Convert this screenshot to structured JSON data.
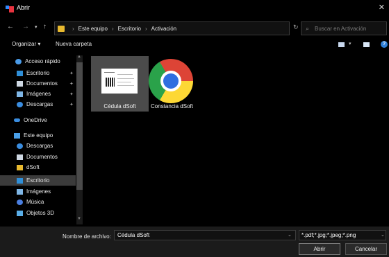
{
  "window": {
    "title": "Abrir",
    "close_icon": "close-icon"
  },
  "nav": {
    "breadcrumb": [
      "Este equipo",
      "Escritorio",
      "Activación"
    ],
    "search_placeholder": "Buscar en Activación"
  },
  "toolbar": {
    "organize": "Organizar ▾",
    "new_folder": "Nueva carpeta",
    "help": "?"
  },
  "sidebar": {
    "items": [
      {
        "label": "Acceso rápido",
        "icon": "star-icon",
        "color": "#4a9be8",
        "pinned": false,
        "selected": false
      },
      {
        "label": "Escritorio",
        "icon": "desktop-icon",
        "color": "#2f8fd8",
        "pinned": true,
        "selected": false
      },
      {
        "label": "Documentos",
        "icon": "documents-icon",
        "color": "#cfd8e3",
        "pinned": true,
        "selected": false
      },
      {
        "label": "Imágenes",
        "icon": "pictures-icon",
        "color": "#7fb6e6",
        "pinned": true,
        "selected": false
      },
      {
        "label": "Descargas",
        "icon": "download-icon",
        "color": "#3a8de0",
        "pinned": true,
        "selected": false
      },
      {
        "label": "OneDrive",
        "icon": "onedrive-icon",
        "color": "#3a8de0",
        "pinned": false,
        "selected": false
      },
      {
        "label": "Este equipo",
        "icon": "computer-icon",
        "color": "#4aa0e8",
        "pinned": false,
        "selected": false
      },
      {
        "label": "Descargas",
        "icon": "download-icon",
        "color": "#3a8de0",
        "pinned": false,
        "selected": false
      },
      {
        "label": "Documentos",
        "icon": "documents-icon",
        "color": "#cfd8e3",
        "pinned": false,
        "selected": false
      },
      {
        "label": "dSoft",
        "icon": "app-icon",
        "color": "#e8b92f",
        "pinned": false,
        "selected": false
      },
      {
        "label": "Escritorio",
        "icon": "desktop-icon",
        "color": "#2f8fd8",
        "pinned": false,
        "selected": true
      },
      {
        "label": "Imágenes",
        "icon": "pictures-icon",
        "color": "#7fb6e6",
        "pinned": false,
        "selected": false
      },
      {
        "label": "Música",
        "icon": "music-icon",
        "color": "#4a7fe0",
        "pinned": false,
        "selected": false
      },
      {
        "label": "Objetos 3D",
        "icon": "objects-3d-icon",
        "color": "#5aaee8",
        "pinned": false,
        "selected": false
      }
    ]
  },
  "files": [
    {
      "label": "Cédula dSoft",
      "kind": "image",
      "selected": true
    },
    {
      "label": "Constancia dSoft",
      "kind": "chrome",
      "selected": false
    }
  ],
  "bottom": {
    "filename_label": "Nombre de archivo:",
    "filename_value": "Cédula dSoft",
    "filter": "*.pdf;*.jpg;*.jpeg;*.png",
    "open": "Abrir",
    "cancel": "Cancelar"
  },
  "colors": {
    "accent": "#2f7fd8",
    "selection": "#4b4b4b"
  }
}
